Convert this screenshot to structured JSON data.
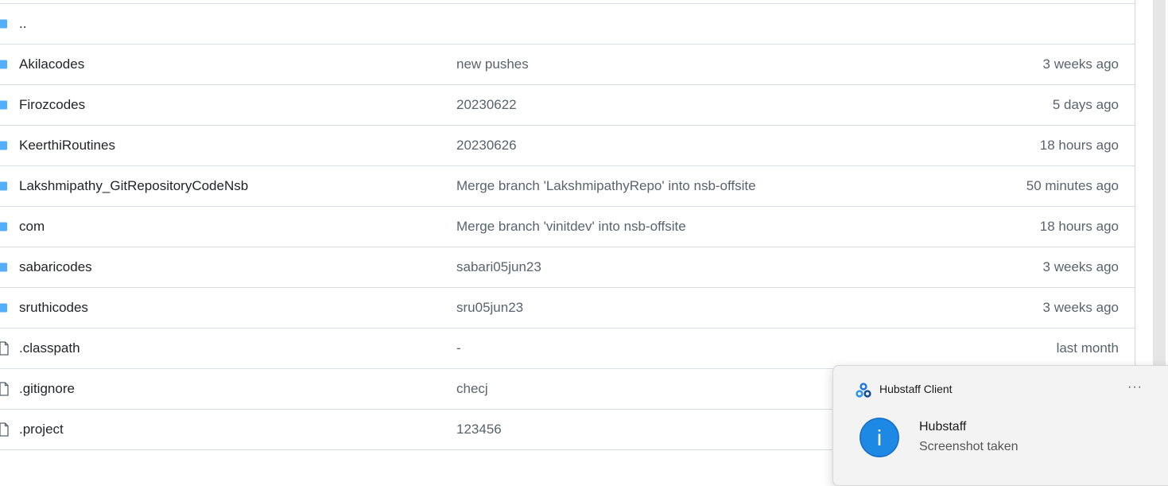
{
  "files": [
    {
      "type": "folder",
      "name": "..",
      "message": "",
      "age": ""
    },
    {
      "type": "folder",
      "name": "Akilacodes",
      "message": "new pushes",
      "age": "3 weeks ago"
    },
    {
      "type": "folder",
      "name": "Firozcodes",
      "message": "20230622",
      "age": "5 days ago"
    },
    {
      "type": "folder",
      "name": "KeerthiRoutines",
      "message": "20230626",
      "age": "18 hours ago"
    },
    {
      "type": "folder",
      "name": "Lakshmipathy_GitRepositoryCodeNsb",
      "message": "Merge branch 'LakshmipathyRepo' into nsb-offsite",
      "age": "50 minutes ago"
    },
    {
      "type": "folder",
      "name": "com",
      "message": "Merge branch 'vinitdev' into nsb-offsite",
      "age": "18 hours ago"
    },
    {
      "type": "folder",
      "name": "sabaricodes",
      "message": "sabari05jun23",
      "age": "3 weeks ago"
    },
    {
      "type": "folder",
      "name": "sruthicodes",
      "message": "sru05jun23",
      "age": "3 weeks ago"
    },
    {
      "type": "file",
      "name": ".classpath",
      "message": "-",
      "age": "last month"
    },
    {
      "type": "file",
      "name": ".gitignore",
      "message": "checj",
      "age": ""
    },
    {
      "type": "file",
      "name": ".project",
      "message": "123456",
      "age": ""
    }
  ],
  "notification": {
    "app_name": "Hubstaff Client",
    "more": "···",
    "title": "Hubstaff",
    "body": "Screenshot taken",
    "info_glyph": "i"
  },
  "colors": {
    "folder": "#54aeff",
    "info": "#1e88e5"
  }
}
